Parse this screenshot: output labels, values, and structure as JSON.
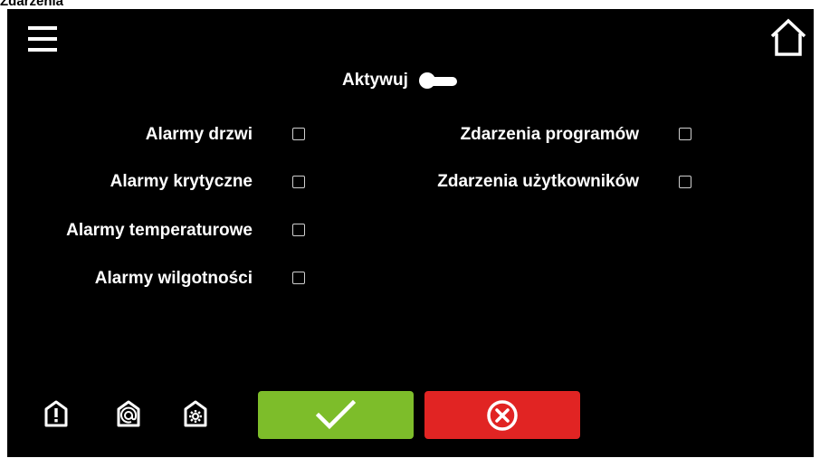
{
  "page": {
    "title": "Zdarzenia"
  },
  "header": {
    "menu_icon": "hamburger-menu-icon",
    "home_icon": "home-icon"
  },
  "activate": {
    "label": "Aktywuj",
    "enabled": false
  },
  "options_left": [
    {
      "label": "Alarmy drzwi",
      "checked": false
    },
    {
      "label": "Alarmy krytyczne",
      "checked": false
    },
    {
      "label": "Alarmy temperaturowe",
      "checked": false
    },
    {
      "label": "Alarmy wilgotności",
      "checked": false
    }
  ],
  "options_right": [
    {
      "label": "Zdarzenia programów",
      "checked": false
    },
    {
      "label": "Zdarzenia użytkowników",
      "checked": false
    }
  ],
  "footer": {
    "icons": [
      "alarm-icon",
      "email-icon",
      "settings-icon"
    ],
    "ok_icon": "checkmark-icon",
    "cancel_icon": "cancel-circle-icon"
  },
  "colors": {
    "background": "#000000",
    "ok": "#7dbd2a",
    "cancel": "#e12423",
    "text": "#ffffff"
  }
}
